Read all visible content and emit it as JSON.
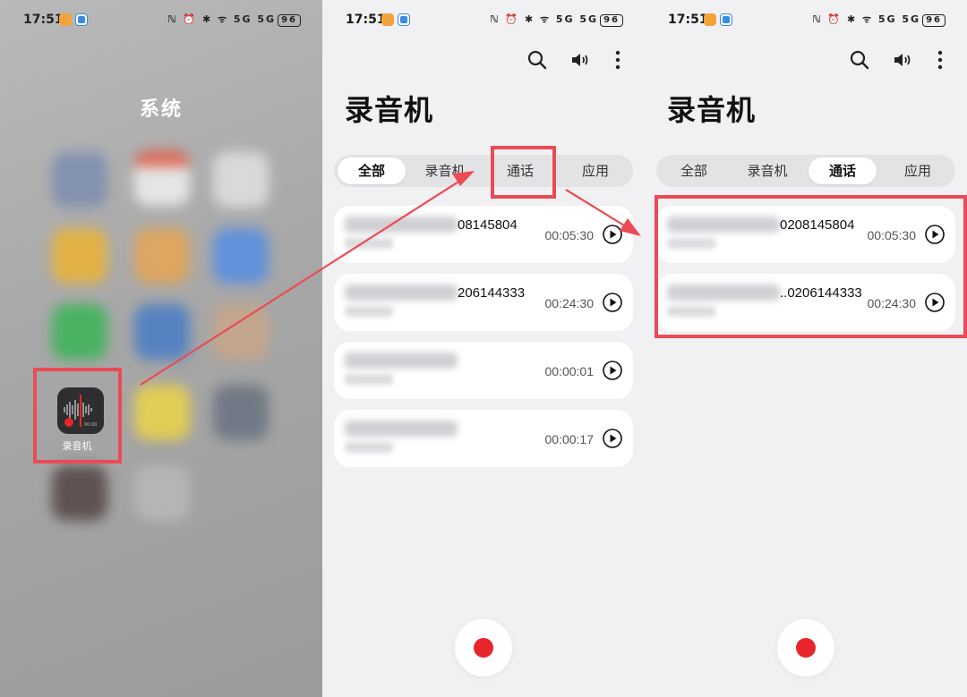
{
  "status_bar": {
    "time": "17:51",
    "indicators": "ℕ ⏰ ✱ ᯤ 5G 5G",
    "battery": "96"
  },
  "home_screen": {
    "folder_title": "系统",
    "app_label": "录音机"
  },
  "app": {
    "title": "录音机",
    "toolbar": [
      "search-icon",
      "speaker-icon",
      "more-icon"
    ],
    "tabs": [
      "全部",
      "录音机",
      "通话",
      "应用"
    ]
  },
  "screen_all": {
    "active_tab": "全部",
    "recordings": [
      {
        "number": "08145804",
        "duration": "00:05:30"
      },
      {
        "number": "206144333",
        "duration": "00:24:30"
      },
      {
        "number": "",
        "duration": "00:00:01"
      },
      {
        "number": "",
        "duration": "00:00:17"
      }
    ]
  },
  "screen_calls": {
    "active_tab": "通话",
    "recordings": [
      {
        "number": "0208145804",
        "duration": "00:05:30"
      },
      {
        "number": "..0206144333",
        "duration": "00:24:30"
      }
    ]
  },
  "colors": {
    "highlight": "#ea4b55",
    "record": "#e8252b",
    "background": "#f1f1f3"
  }
}
